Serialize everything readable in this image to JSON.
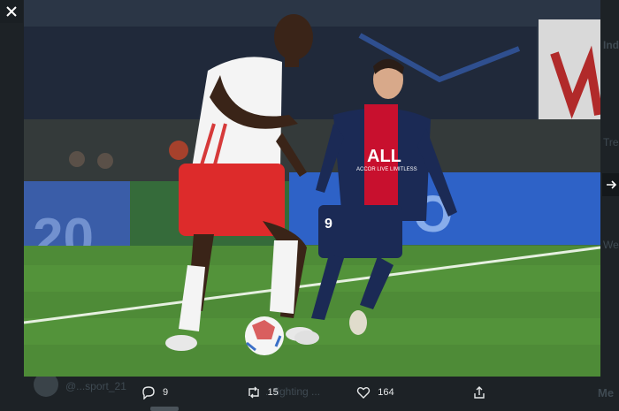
{
  "background": {
    "handle": "@...sport_21",
    "text": "...fighting ...",
    "right_column": [
      "Ind",
      "Tre",
      "We",
      "Me"
    ]
  },
  "controls": {
    "close_icon": "close-icon",
    "next_icon": "arrow-right-icon"
  },
  "photo": {
    "description_icon": "photo",
    "sponsor_text": "ALL",
    "sponsor_subtext": "ACCOR LIVE LIMITLESS",
    "player_number": "9",
    "board_text": "20"
  },
  "actions": {
    "replies": {
      "icon": "reply-icon",
      "count": "9"
    },
    "retweets": {
      "icon": "retweet-icon",
      "count": "15"
    },
    "likes": {
      "icon": "like-icon",
      "count": "164"
    },
    "share": {
      "icon": "share-icon"
    }
  },
  "colors": {
    "overlay": "#1d2226",
    "pitch": "#4f8a3a",
    "psg_navy": "#1b2a55",
    "psg_red": "#c8102e",
    "leipzig_red": "#dd2b2b",
    "text": "#e7e9ea"
  }
}
